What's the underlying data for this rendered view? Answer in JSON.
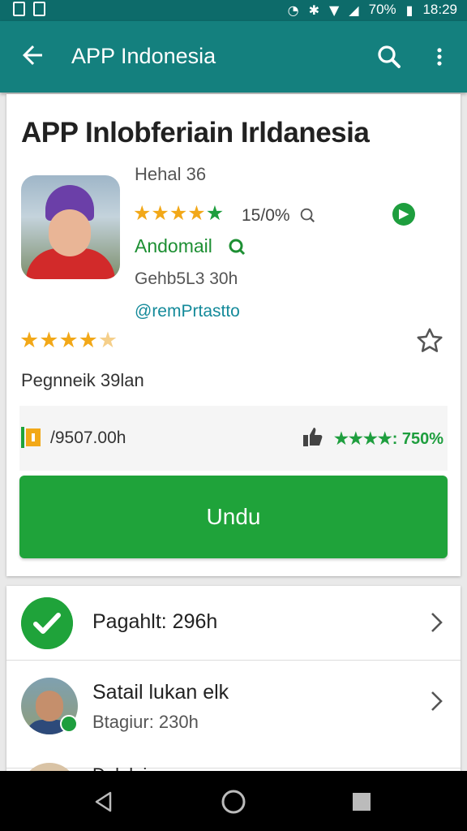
{
  "status_bar": {
    "time": "18:29",
    "battery": "70%",
    "icons": [
      "nfc-icon",
      "bluetooth-icon",
      "wifi-icon",
      "signal-icon",
      "battery-icon"
    ]
  },
  "app_bar": {
    "title": "APP Indonesia",
    "icons": [
      "back-arrow-icon",
      "search-icon",
      "more-vert-icon"
    ]
  },
  "app": {
    "name": "APP Inlobferiain Irldanesia",
    "detail": "Hehal 36",
    "rating_percent": "15/0%",
    "developer": "Andomail",
    "size": "Gehb5L3 30h",
    "link": "@remPrtastto",
    "stars": 4.5,
    "reviews": "Pegnneik 39lan",
    "price": "/9507.00h",
    "rating_summary": "★★★★: 750%",
    "install_label": "Undu"
  },
  "list": [
    {
      "title": "Pagahlt: 296h"
    },
    {
      "title": "Satail lukan elk",
      "subtitle": "Btagiur: 230h"
    },
    {
      "title": "Dulelai..."
    }
  ],
  "colors": {
    "appbar": "#14807e",
    "statusbar": "#0d6b6a",
    "accent_green": "#1fa33a",
    "star_yellow": "#f2a818",
    "link": "#148a9a"
  }
}
